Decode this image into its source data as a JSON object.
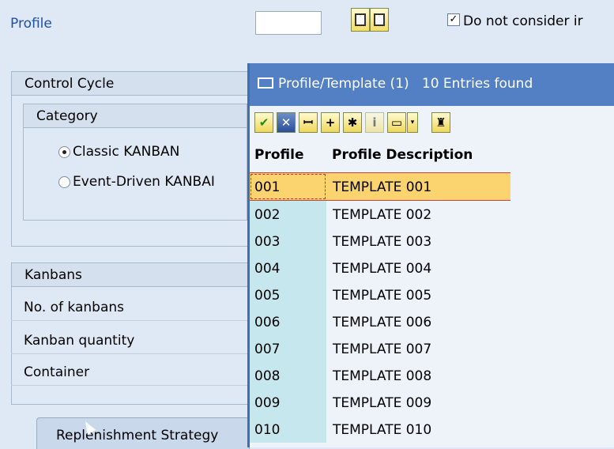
{
  "header": {
    "profile_label": "Profile",
    "profile_value": "",
    "checkbox_checked_mark": "✓",
    "checkbox_label": "Do not consider ir"
  },
  "control_cycle": {
    "title": "Control Cycle",
    "category_title": "Category",
    "options": [
      {
        "label": "Classic KANBAN",
        "selected": true
      },
      {
        "label": "Event-Driven KANBAI",
        "selected": false
      }
    ]
  },
  "kanbans": {
    "title": "Kanbans",
    "fields": [
      "No. of kanbans",
      "Kanban quantity",
      "Container"
    ]
  },
  "tabs": {
    "replenishment": "Replenishment Strategy"
  },
  "popup": {
    "title": "Profile/Template (1)",
    "entries_found": "10 Entries found",
    "columns": [
      "Profile",
      "Profile Description"
    ],
    "rows": [
      {
        "profile": "001",
        "description": "TEMPLATE 001"
      },
      {
        "profile": "002",
        "description": "TEMPLATE 002"
      },
      {
        "profile": "003",
        "description": "TEMPLATE 003"
      },
      {
        "profile": "004",
        "description": "TEMPLATE 004"
      },
      {
        "profile": "005",
        "description": "TEMPLATE 005"
      },
      {
        "profile": "006",
        "description": "TEMPLATE 006"
      },
      {
        "profile": "007",
        "description": "TEMPLATE 007"
      },
      {
        "profile": "008",
        "description": "TEMPLATE 008"
      },
      {
        "profile": "009",
        "description": "TEMPLATE 009"
      },
      {
        "profile": "010",
        "description": "TEMPLATE 010"
      }
    ],
    "selected_row_index": 0,
    "toolbar_icons": [
      "checkmark-icon",
      "close-icon",
      "find-icon",
      "find-next-icon",
      "multiple-select-icon",
      "information-icon",
      "print-icon",
      "dropdown-arrow-icon",
      "stamp-icon"
    ]
  },
  "colors": {
    "title_bar": "#5380c4",
    "selected_row": "#fbd36f",
    "key_column": "#c6e7ee",
    "link_blue": "#1f4fa8"
  }
}
